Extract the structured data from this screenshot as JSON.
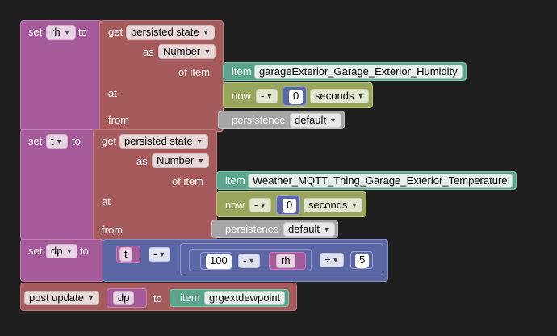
{
  "blocks": {
    "set_rh": {
      "set": "set",
      "var": "rh",
      "to": "to"
    },
    "get_rh": {
      "get": "get",
      "state": "persisted state",
      "as": "as",
      "type": "Number",
      "of_item": "of item",
      "at": "at",
      "from": "from"
    },
    "item_rh": {
      "label": "item",
      "name": "garageExterior_Garage_Exterior_Humidity"
    },
    "now_rh": {
      "label": "now",
      "op": "-",
      "value": "0",
      "unit": "seconds"
    },
    "pers_rh": {
      "label": "persistence",
      "service": "default"
    },
    "set_t": {
      "set": "set",
      "var": "t",
      "to": "to"
    },
    "get_t": {
      "get": "get",
      "state": "persisted state",
      "as": "as",
      "type": "Number",
      "of_item": "of item",
      "at": "at",
      "from": "from"
    },
    "item_t": {
      "label": "item",
      "name": "Weather_MQTT_Thing_Garage_Exterior_Temperature"
    },
    "now_t": {
      "label": "now",
      "op": "-",
      "value": "0",
      "unit": "seconds"
    },
    "pers_t": {
      "label": "persistence",
      "service": "default"
    },
    "set_dp": {
      "set": "set",
      "var": "dp",
      "to": "to"
    },
    "math": {
      "var_t": "t",
      "op1": "-",
      "num100": "100",
      "op2": "-",
      "var_rh": "rh",
      "op3": "÷",
      "num5": "5"
    },
    "post": {
      "label": "post update",
      "var": "dp",
      "to": "to",
      "item_label": "item",
      "item_name": "grgextdewpoint"
    }
  },
  "colors": {
    "background": "#1e1e1e",
    "variables": "#a55b99",
    "persistence": "#a55b5b",
    "item": "#5ba58c",
    "now": "#99a55b",
    "service": "#a5a5a5",
    "math": "#5b67a5"
  }
}
